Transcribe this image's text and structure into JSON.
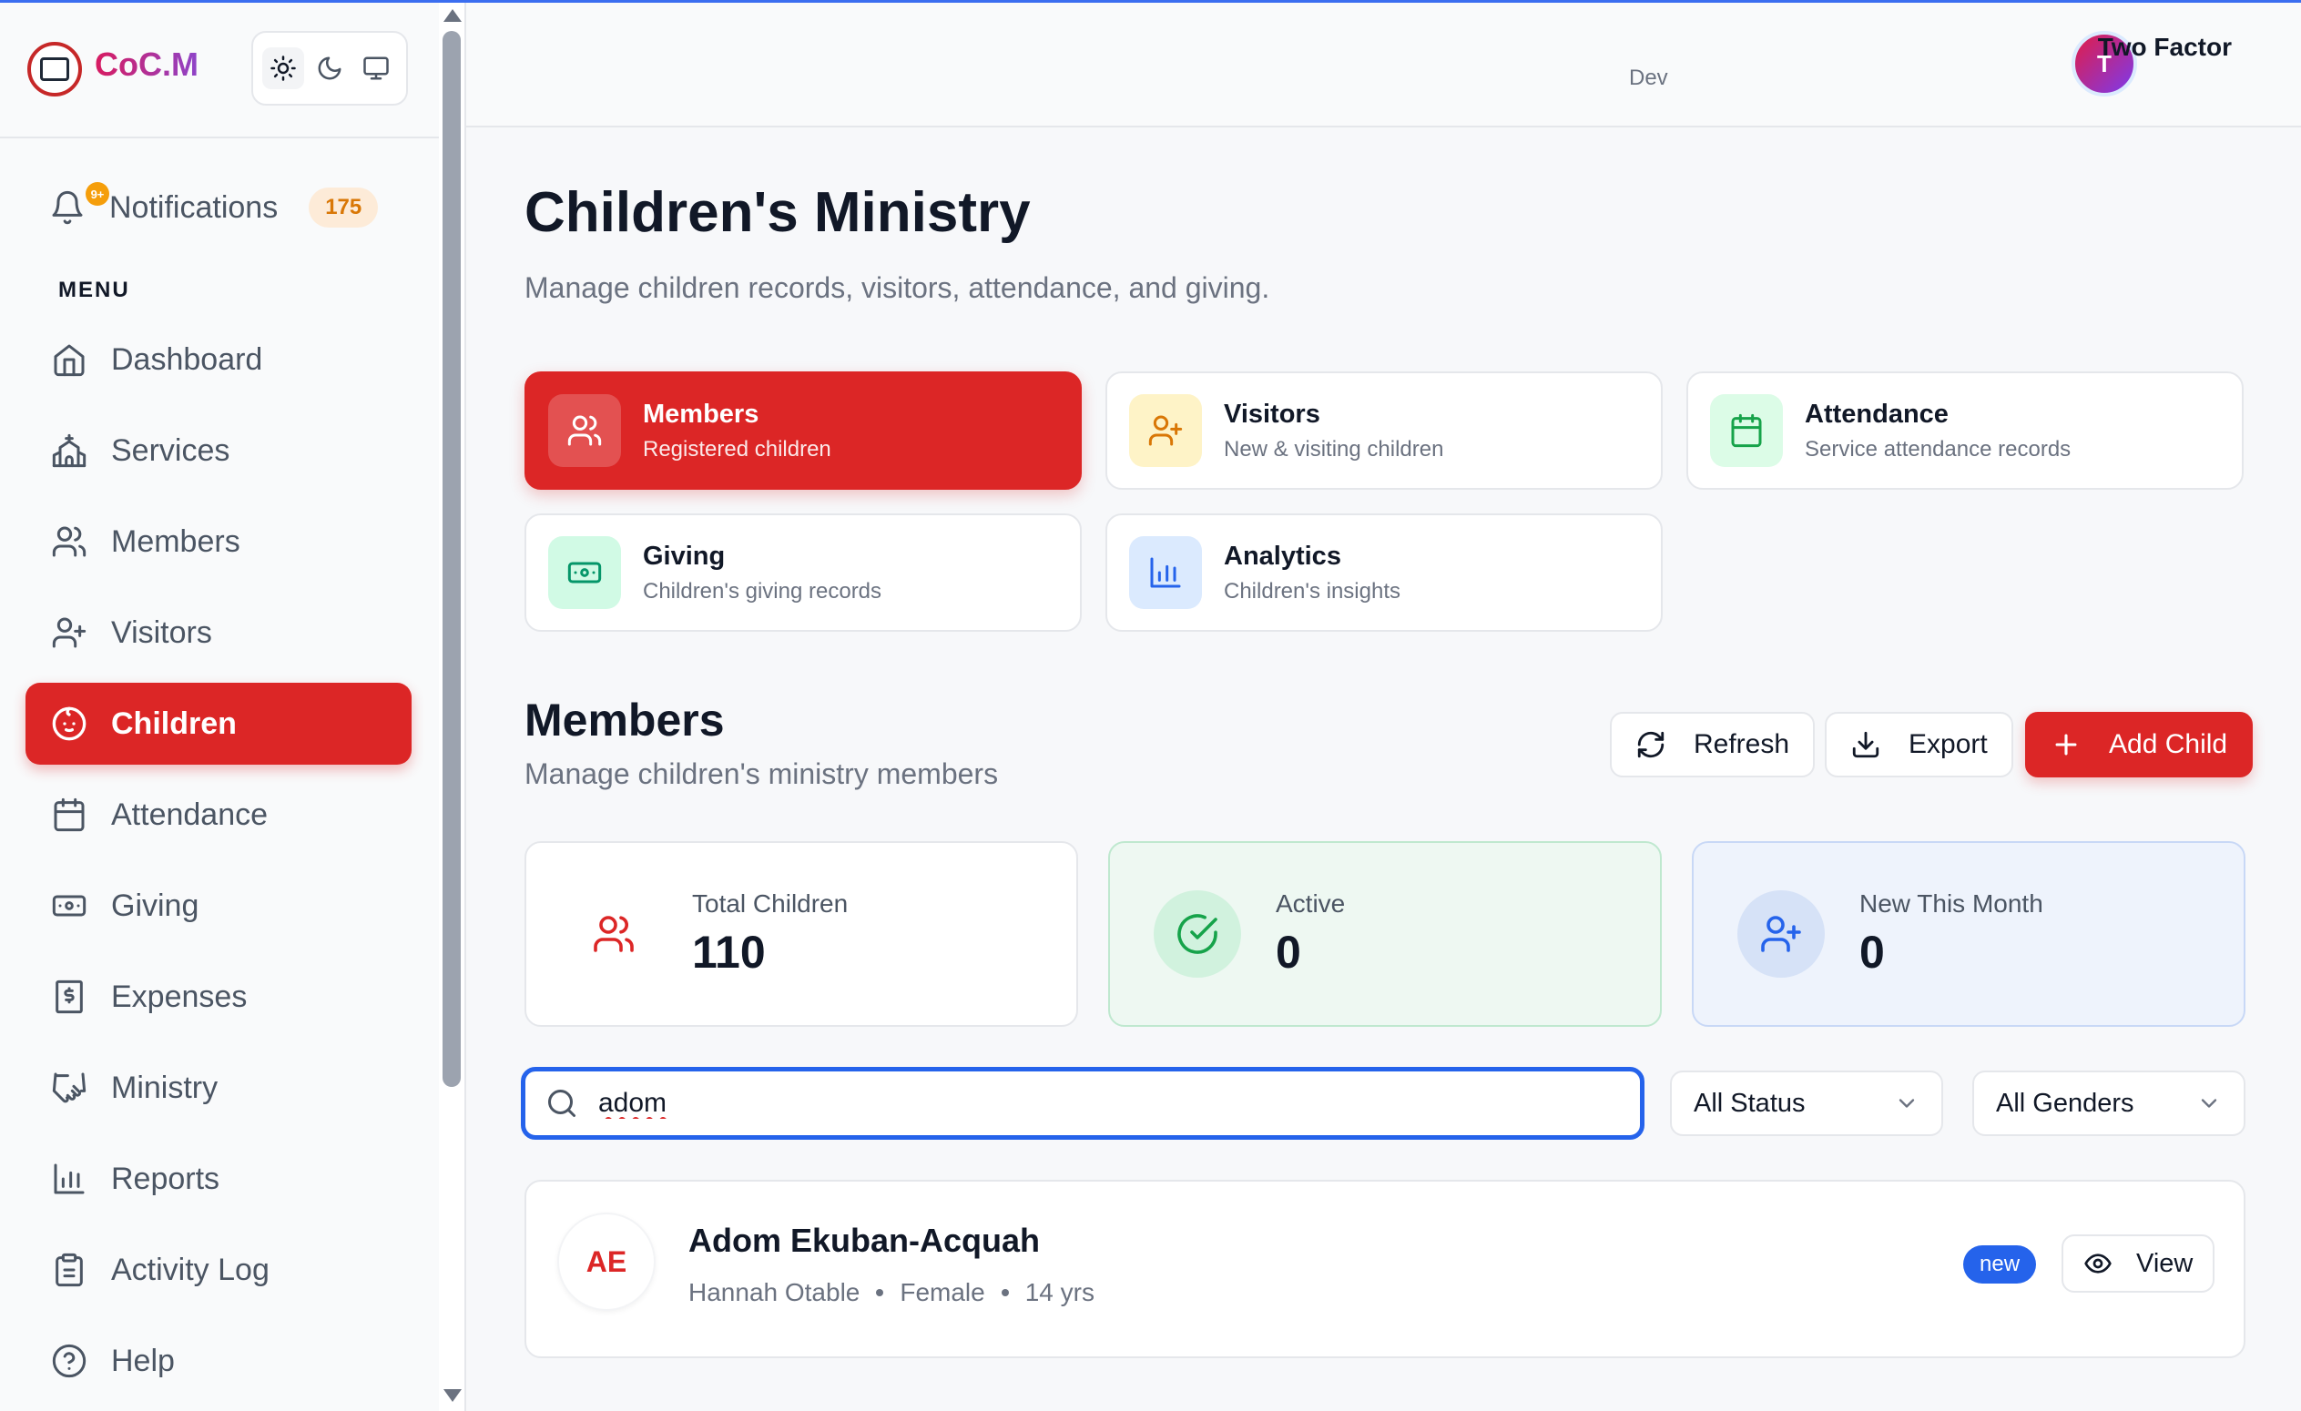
{
  "brand": {
    "name": "CoC.M"
  },
  "notifications": {
    "label": "Notifications",
    "count": "175",
    "dot": "9+"
  },
  "menu_heading": "MENU",
  "nav": [
    {
      "label": "Dashboard",
      "icon": "home-icon"
    },
    {
      "label": "Services",
      "icon": "church-icon"
    },
    {
      "label": "Members",
      "icon": "users-icon"
    },
    {
      "label": "Visitors",
      "icon": "user-plus-icon"
    },
    {
      "label": "Children",
      "icon": "baby-icon",
      "active": true
    },
    {
      "label": "Attendance",
      "icon": "calendar-icon"
    },
    {
      "label": "Giving",
      "icon": "banknote-icon"
    },
    {
      "label": "Expenses",
      "icon": "receipt-icon"
    },
    {
      "label": "Ministry",
      "icon": "handshake-icon"
    },
    {
      "label": "Reports",
      "icon": "bar-chart-icon"
    },
    {
      "label": "Activity Log",
      "icon": "clipboard-icon"
    },
    {
      "label": "Help",
      "icon": "help-circle-icon"
    }
  ],
  "user": {
    "initial": "T",
    "name": "Two Factor",
    "role": "Dev"
  },
  "page": {
    "title": "Children's Ministry",
    "subtitle": "Manage children records, visitors, attendance, and giving."
  },
  "tabs": [
    {
      "title": "Members",
      "desc": "Registered children",
      "icon": "users-icon",
      "active": true
    },
    {
      "title": "Visitors",
      "desc": "New & visiting children",
      "icon": "user-plus-icon"
    },
    {
      "title": "Attendance",
      "desc": "Service attendance records",
      "icon": "calendar-icon"
    },
    {
      "title": "Giving",
      "desc": "Children's giving records",
      "icon": "banknote-icon"
    },
    {
      "title": "Analytics",
      "desc": "Children's insights",
      "icon": "bar-chart-icon"
    }
  ],
  "section": {
    "title": "Members",
    "subtitle": "Manage children's ministry members",
    "refresh_label": "Refresh",
    "export_label": "Export",
    "add_label": "Add Child"
  },
  "stats": [
    {
      "label": "Total Children",
      "value": "110"
    },
    {
      "label": "Active",
      "value": "0"
    },
    {
      "label": "New This Month",
      "value": "0"
    }
  ],
  "search": {
    "value": "adom"
  },
  "filters": {
    "status": "All Status",
    "gender": "All Genders"
  },
  "results": [
    {
      "initials": "AE",
      "name": "Adom Ekuban-Acquah",
      "guardian": "Hannah Otable",
      "gender": "Female",
      "age": "14 yrs",
      "badge": "new",
      "view_label": "View"
    }
  ],
  "colors": {
    "accent": "#dc2626",
    "focus": "#2563eb",
    "success": "#16a34a"
  }
}
